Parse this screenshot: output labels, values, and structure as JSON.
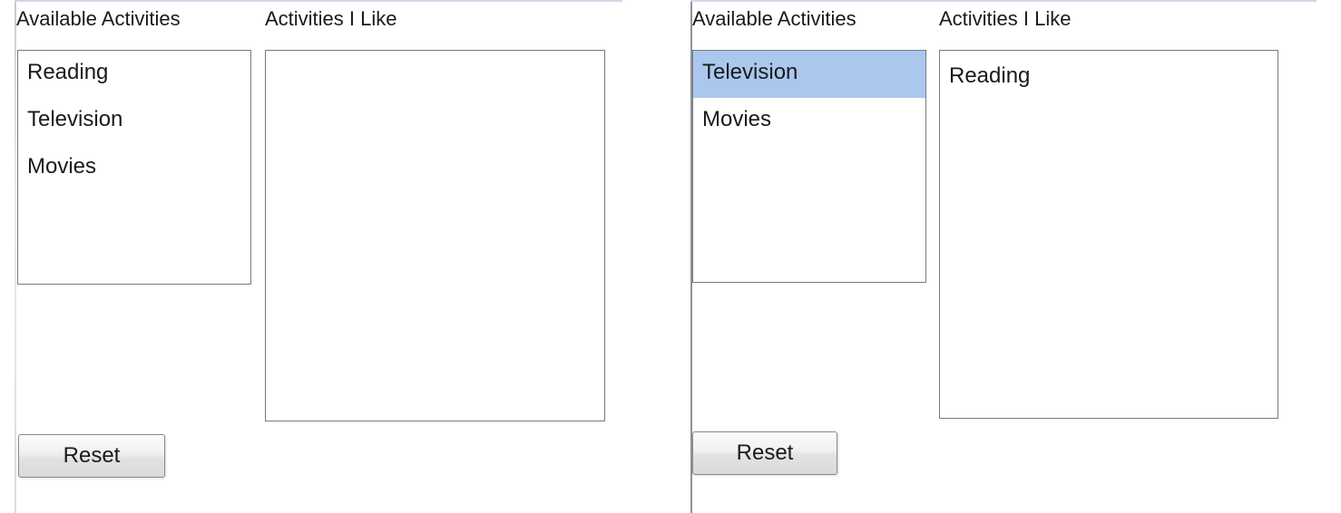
{
  "panels": [
    {
      "available_label": "Available Activities",
      "liked_label": "Activities I Like",
      "available_items": [
        "Reading",
        "Television",
        "Movies"
      ],
      "liked_items": [],
      "reset_label": "Reset"
    },
    {
      "available_label": "Available Activities",
      "liked_label": "Activities I Like",
      "available_items": [
        "Television",
        "Movies"
      ],
      "available_selected": "Television",
      "liked_items": [
        "Reading"
      ],
      "reset_label": "Reset"
    }
  ],
  "colors": {
    "selection": "#abc7ee",
    "list_border": "#7a7a7a",
    "background": "#ffffff"
  }
}
